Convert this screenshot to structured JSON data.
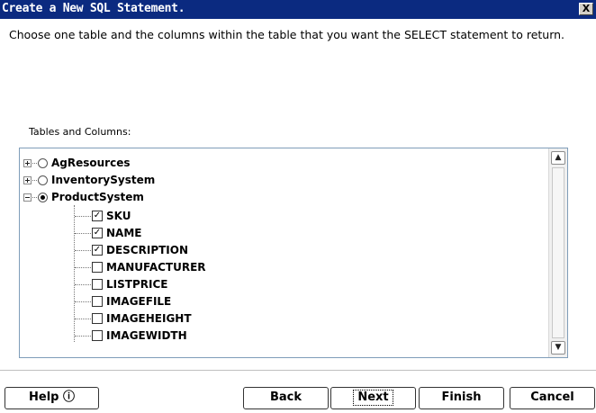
{
  "dialog": {
    "title": "Create a New SQL Statement.",
    "close_label": "X",
    "instructions": "Choose one table and the columns within the table that you want the SELECT statement to return.",
    "tables_label": "Tables and Columns:"
  },
  "tree": {
    "tables": [
      {
        "name": "AgResources",
        "expanded": false,
        "selected": false
      },
      {
        "name": "InventorySystem",
        "expanded": false,
        "selected": false
      },
      {
        "name": "ProductSystem",
        "expanded": true,
        "selected": true
      }
    ],
    "columns": [
      {
        "name": "SKU",
        "checked": true
      },
      {
        "name": "NAME",
        "checked": true
      },
      {
        "name": "DESCRIPTION",
        "checked": true
      },
      {
        "name": "MANUFACTURER",
        "checked": false
      },
      {
        "name": "LISTPRICE",
        "checked": false
      },
      {
        "name": "IMAGEFILE",
        "checked": false
      },
      {
        "name": "IMAGEHEIGHT",
        "checked": false
      },
      {
        "name": "IMAGEWIDTH",
        "checked": false
      }
    ]
  },
  "scrollbar": {
    "up_glyph": "▲",
    "down_glyph": "▼"
  },
  "buttons": {
    "help": "Help ⓘ",
    "back": "Back",
    "next": "Next",
    "finish": "Finish",
    "cancel": "Cancel"
  },
  "colors": {
    "titlebar": "#0b2a80",
    "border": "#7f9db9"
  }
}
